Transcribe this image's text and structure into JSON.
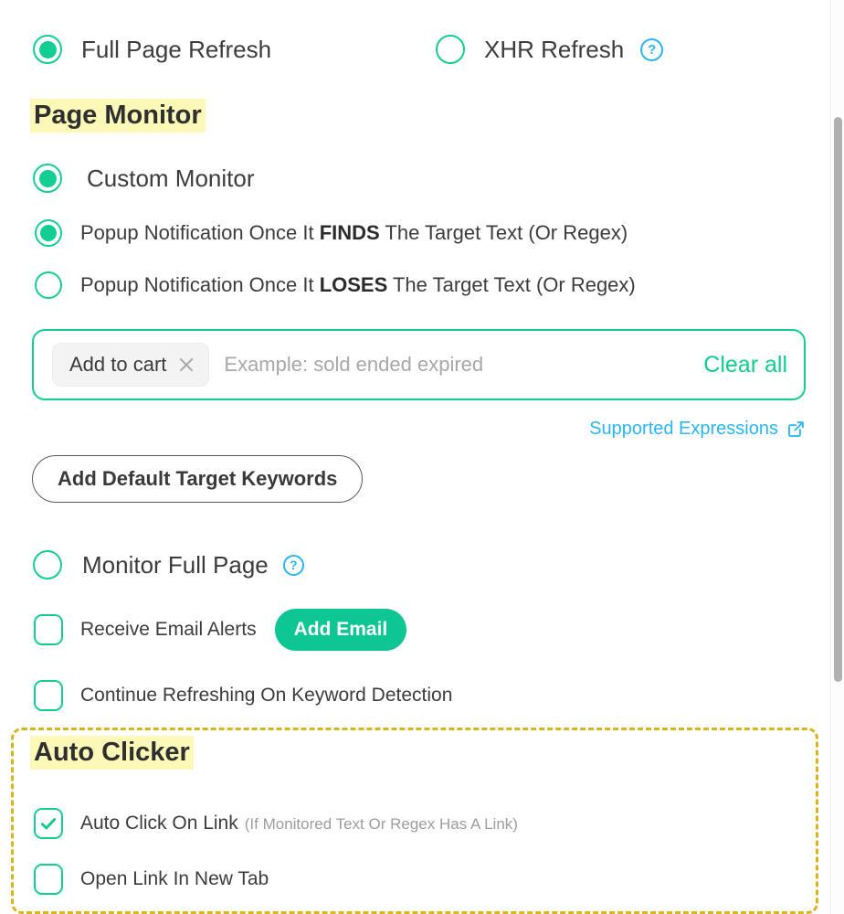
{
  "refresh_mode": {
    "options": [
      {
        "label": "Full Page Refresh",
        "selected": true,
        "help": false
      },
      {
        "label": "XHR Refresh",
        "selected": false,
        "help": true,
        "help_glyph": "?"
      }
    ]
  },
  "page_monitor": {
    "heading": "Page Monitor",
    "monitor_mode": {
      "label": "Custom Monitor",
      "selected": true
    },
    "popup_options": [
      {
        "prefix": "Popup Notification Once It ",
        "emphasis": "FINDS",
        "suffix": " The Target Text (Or Regex)",
        "selected": true
      },
      {
        "prefix": "Popup Notification Once It ",
        "emphasis": "LOSES",
        "suffix": " The Target Text (Or Regex)",
        "selected": false
      }
    ],
    "keyword_input": {
      "chips": [
        {
          "text": "Add to cart"
        }
      ],
      "placeholder": "Example: sold ended expired",
      "value": "",
      "clear_all_label": "Clear all"
    },
    "supported_expressions": {
      "label": "Supported Expressions",
      "icon": "external-link-icon"
    },
    "add_default_keywords_label": "Add Default Target Keywords",
    "monitor_full_page": {
      "label": "Monitor Full Page",
      "selected": false,
      "help_glyph": "?"
    },
    "email_alerts": {
      "label": "Receive Email Alerts",
      "checked": false,
      "button_label": "Add Email"
    },
    "continue_refreshing": {
      "label": "Continue Refreshing On Keyword Detection",
      "checked": false
    }
  },
  "auto_clicker": {
    "heading": "Auto Clicker",
    "auto_click_on_link": {
      "label": "Auto Click On Link",
      "sub_label": "(If Monitored Text Or Regex Has A Link)",
      "checked": true
    },
    "open_link_new_tab": {
      "label": "Open Link In New Tab",
      "checked": false
    }
  },
  "colors": {
    "accent_green": "#13ce93",
    "link_blue": "#29b6f6",
    "highlight_yellow": "#fbf8b8",
    "dashed_gold": "#d9b520",
    "text_dark": "#3c3c3c",
    "text_muted": "#9d9d9d"
  }
}
